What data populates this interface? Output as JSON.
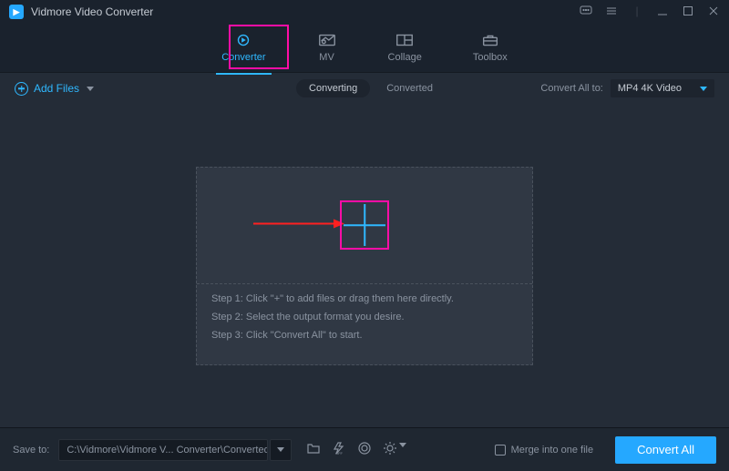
{
  "app": {
    "title": "Vidmore Video Converter"
  },
  "nav": {
    "items": [
      {
        "label": "Converter"
      },
      {
        "label": "MV"
      },
      {
        "label": "Collage"
      },
      {
        "label": "Toolbox"
      }
    ]
  },
  "toolbar": {
    "add_files": "Add Files",
    "converting": "Converting",
    "converted": "Converted",
    "convert_all_to": "Convert All to:",
    "selected_format": "MP4 4K Video"
  },
  "dropzone": {
    "step1": "Step 1: Click \"+\" to add files or drag them here directly.",
    "step2": "Step 2: Select the output format you desire.",
    "step3": "Step 3: Click \"Convert All\" to start."
  },
  "footer": {
    "save_to_label": "Save to:",
    "save_path": "C:\\Vidmore\\Vidmore V... Converter\\Converted",
    "merge_label": "Merge into one file",
    "convert_all": "Convert All"
  }
}
